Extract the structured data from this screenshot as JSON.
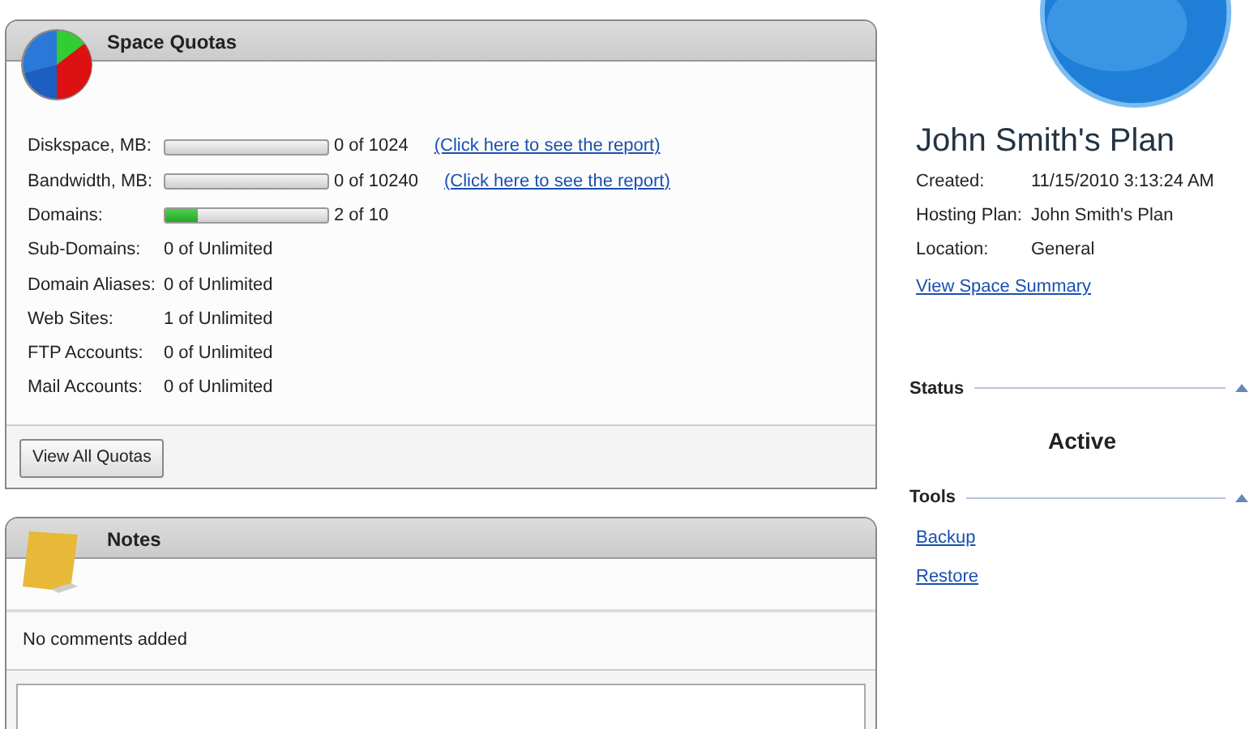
{
  "space_quotas": {
    "title": "Space Quotas",
    "rows": [
      {
        "kind": "bar",
        "label": "Diskspace, MB:",
        "level": 0,
        "value": "0 of 1024",
        "link": "(Click here to see the report)"
      },
      {
        "kind": "bar",
        "label": "Bandwidth, MB:",
        "level": 0,
        "value": "0 of 10240",
        "link": "(Click here to see the report)"
      },
      {
        "kind": "bar",
        "label": "Domains:",
        "level": 0.2,
        "value": "2 of 10"
      },
      {
        "kind": "text",
        "label": "Sub-Domains:",
        "value": "0 of Unlimited"
      },
      {
        "kind": "text",
        "label": "Domain Aliases:",
        "value": "0 of Unlimited"
      },
      {
        "kind": "text",
        "label": "Web Sites:",
        "value": "1 of Unlimited"
      },
      {
        "kind": "text",
        "label": "FTP Accounts:",
        "value": "0 of Unlimited"
      },
      {
        "kind": "text",
        "label": "Mail Accounts:",
        "value": "0 of Unlimited"
      }
    ],
    "button": "View All Quotas"
  },
  "notes": {
    "title": "Notes",
    "message": "No comments added"
  },
  "plan": {
    "title": "John Smith's Plan",
    "details": [
      {
        "label": "Created:",
        "value": "11/15/2010 3:13:24 AM"
      },
      {
        "label": "Hosting Plan:",
        "value": "John Smith's Plan"
      },
      {
        "label": "Location:",
        "value": "General"
      }
    ],
    "link": "View Space Summary"
  },
  "status": {
    "title": "Status",
    "value": "Active"
  },
  "tools": {
    "title": "Tools",
    "links": [
      "Backup",
      "Restore"
    ]
  }
}
